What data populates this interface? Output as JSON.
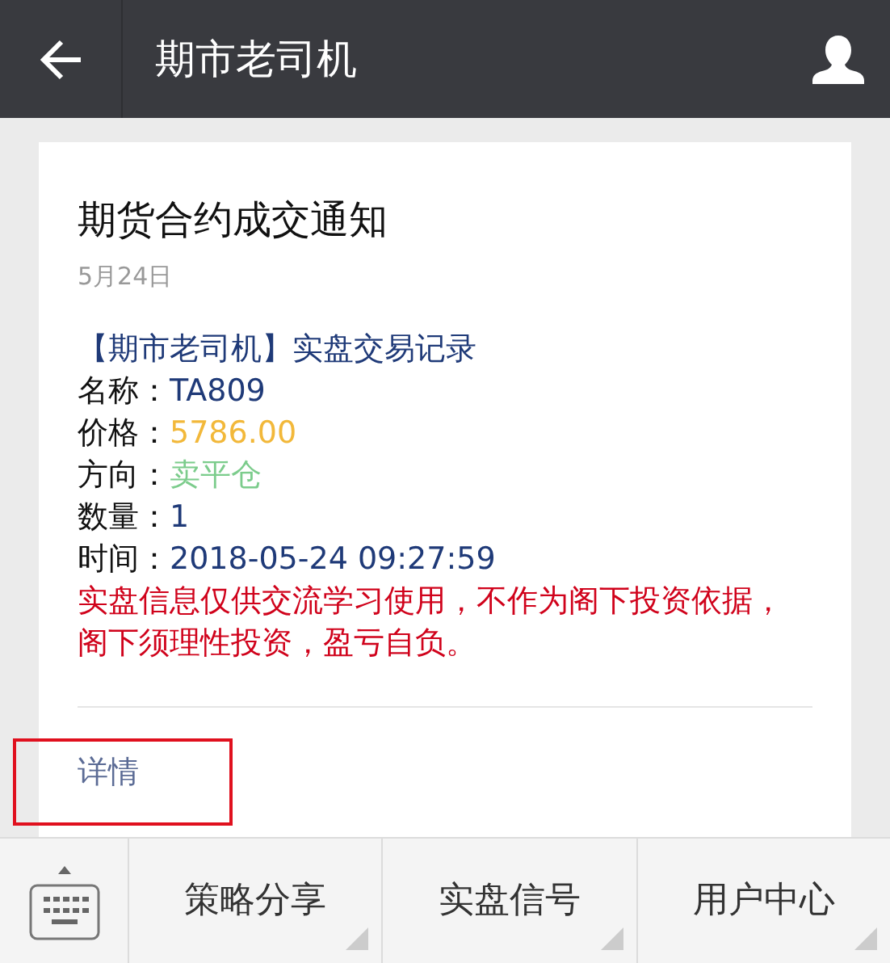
{
  "header": {
    "title": "期市老司机"
  },
  "card": {
    "title": "期货合约成交通知",
    "date": "5月24日",
    "heading": "【期市老司机】实盘交易记录",
    "fields": [
      {
        "label": "名称：",
        "value": "TA809",
        "color": "#1f3a78"
      },
      {
        "label": "价格：",
        "value": "5786.00",
        "color": "#f2b83a"
      },
      {
        "label": "方向：",
        "value": "卖平仓",
        "color": "#7ccc8c"
      },
      {
        "label": "数量：",
        "value": "1",
        "color": "#1f3a78"
      },
      {
        "label": "时间：",
        "value": "2018-05-24 09:27:59",
        "color": "#1f3a78"
      }
    ],
    "notice": "实盘信息仅供交流学习使用，不作为阁下投资依据，阁下须理性投资，盈亏自负。",
    "details": {
      "label": "详情",
      "highlighted": true
    }
  },
  "menu": [
    "策略分享",
    "实盘信号",
    "用户中心"
  ]
}
